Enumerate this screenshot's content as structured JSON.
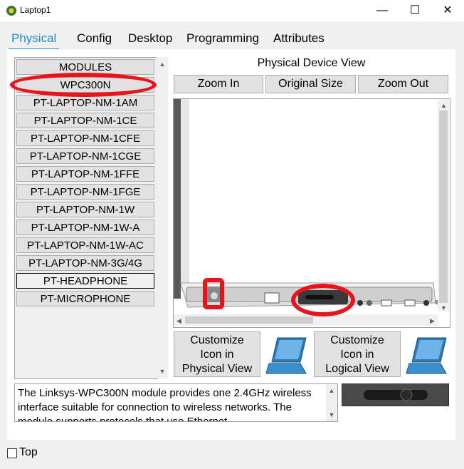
{
  "window": {
    "title": "Laptop1",
    "minimize": "—",
    "maximize": "☐",
    "close": "✕"
  },
  "tabs": [
    {
      "label": "Physical"
    },
    {
      "label": "Config"
    },
    {
      "label": "Desktop"
    },
    {
      "label": "Programming"
    },
    {
      "label": "Attributes"
    }
  ],
  "modules": {
    "header": "MODULES",
    "items": [
      "WPC300N",
      "PT-LAPTOP-NM-1AM",
      "PT-LAPTOP-NM-1CE",
      "PT-LAPTOP-NM-1CFE",
      "PT-LAPTOP-NM-1CGE",
      "PT-LAPTOP-NM-1FFE",
      "PT-LAPTOP-NM-1FGE",
      "PT-LAPTOP-NM-1W",
      "PT-LAPTOP-NM-1W-A",
      "PT-LAPTOP-NM-1W-AC",
      "PT-LAPTOP-NM-3G/4G",
      "PT-HEADPHONE",
      "PT-MICROPHONE"
    ]
  },
  "view": {
    "title": "Physical Device View",
    "zoom_in": "Zoom In",
    "original_size": "Original Size",
    "zoom_out": "Zoom Out"
  },
  "customize": {
    "physical": [
      "Customize",
      "Icon in",
      "Physical View"
    ],
    "logical": [
      "Customize",
      "Icon in",
      "Logical View"
    ]
  },
  "description": "The Linksys-WPC300N module provides one 2.4GHz wireless interface suitable for connection to wireless networks. The module supports protocols that use Ethernet",
  "top_label": "Top",
  "colors": {
    "accent": "#1b8bd6",
    "annotation": "#e8141b"
  }
}
